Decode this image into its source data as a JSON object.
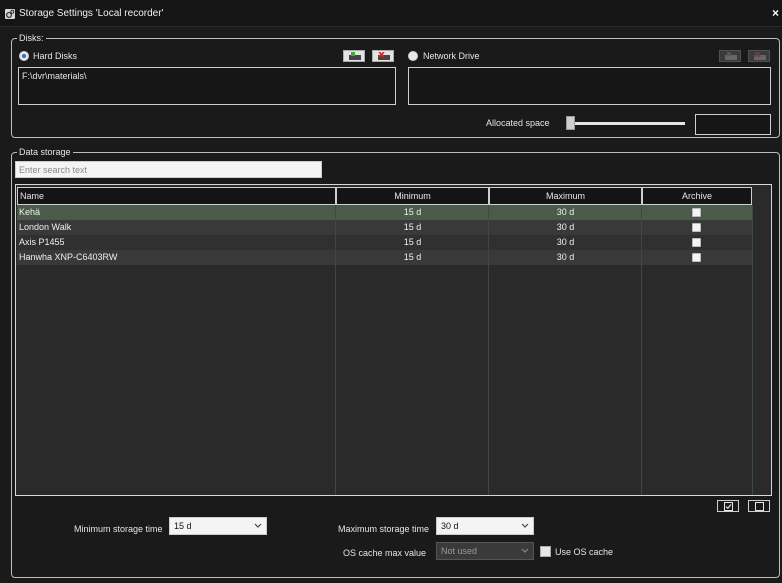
{
  "window": {
    "title": "Storage Settings 'Local recorder'"
  },
  "disks": {
    "legend": "Disks:",
    "hard_disks": {
      "label": "Hard Disks",
      "selected": true,
      "path": "F:\\dvr\\materials\\"
    },
    "network_drive": {
      "label": "Network Drive",
      "selected": false,
      "path": ""
    },
    "allocated_space": {
      "label": "Allocated space",
      "value": ""
    }
  },
  "data_storage": {
    "legend": "Data storage",
    "search": {
      "placeholder": "Enter search text",
      "value": ""
    },
    "columns": [
      "Name",
      "Minimum",
      "Maximum",
      "Archive"
    ],
    "rows": [
      {
        "name": "Kehä",
        "minimum": "15 d",
        "maximum": "30 d",
        "archive": false,
        "selected": true
      },
      {
        "name": "London Walk",
        "minimum": "15 d",
        "maximum": "30 d",
        "archive": false,
        "selected": false
      },
      {
        "name": "Axis P1455",
        "minimum": "15 d",
        "maximum": "30 d",
        "archive": false,
        "selected": false
      },
      {
        "name": "Hanwha XNP-C6403RW",
        "minimum": "15 d",
        "maximum": "30 d",
        "archive": false,
        "selected": false
      }
    ]
  },
  "settings": {
    "min_storage": {
      "label": "Minimum storage time",
      "value": "15 d"
    },
    "max_storage": {
      "label": "Maximum storage time",
      "value": "30 d"
    },
    "os_cache": {
      "label": "OS cache max value",
      "value": "Not used"
    },
    "use_os_cache": {
      "label": "Use OS cache",
      "checked": false
    }
  },
  "colors": {
    "selected_row": "#4a5c49",
    "row_even": "#303030",
    "row_odd": "#393939",
    "accent": "#2a6bc7"
  }
}
